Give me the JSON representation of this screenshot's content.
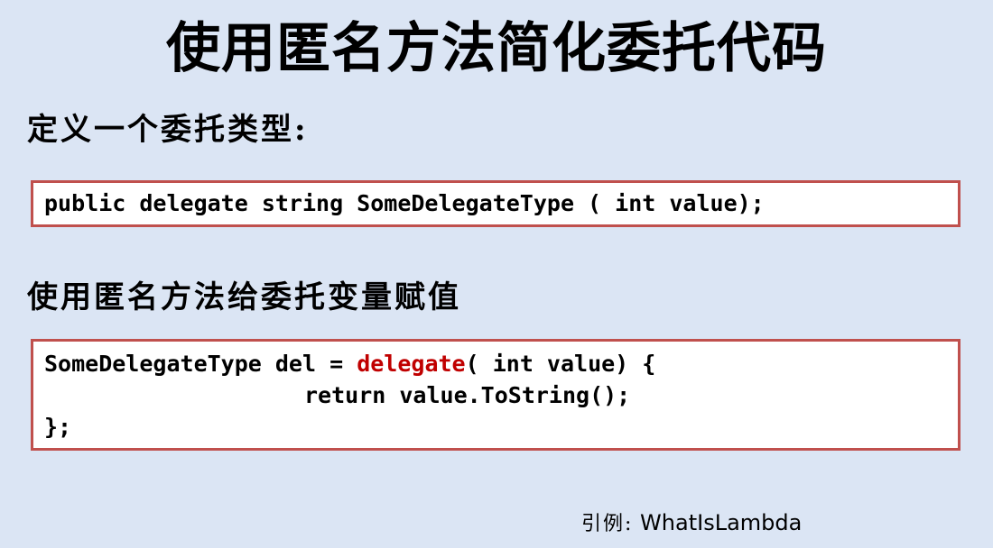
{
  "slide": {
    "title": "使用匿名方法简化委托代码",
    "section1": {
      "label": "定义一个委托类型:",
      "code": "public delegate string SomeDelegateType ( int value);"
    },
    "section2": {
      "label": "使用匿名方法给委托变量赋值",
      "code": {
        "line1_pre": "SomeDelegateType del = ",
        "line1_keyword": "delegate",
        "line1_post": "( int value) {",
        "line2": "return value.ToString();",
        "line3": "};"
      }
    },
    "citation": {
      "prefix": "引例:",
      "text": " WhatIsLambda"
    }
  },
  "colors": {
    "background": "#dbe5f4",
    "box_border": "#c0504d",
    "keyword": "#c00000"
  }
}
